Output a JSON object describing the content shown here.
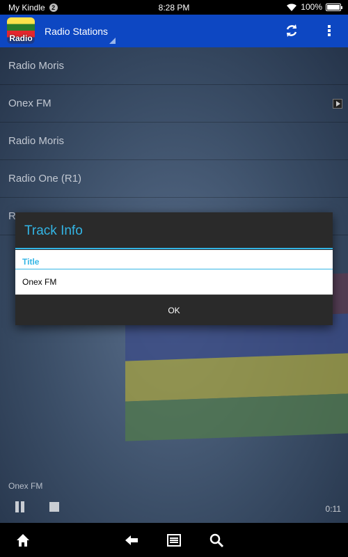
{
  "status_bar": {
    "device_name": "My Kindle",
    "notification_count": "2",
    "time": "8:28 PM",
    "battery_percent": "100%",
    "battery_level": 1.0,
    "icons": [
      "wifi-icon",
      "battery-icon"
    ]
  },
  "action_bar": {
    "app_icon_label": "Radio",
    "title": "Radio Stations",
    "actions": [
      "refresh-icon",
      "overflow-menu-icon"
    ],
    "color": "#0d47c2"
  },
  "stations": [
    {
      "name": "Radio Moris",
      "has_play": false
    },
    {
      "name": "Onex FM",
      "has_play": true
    },
    {
      "name": "Radio Moris",
      "has_play": false
    },
    {
      "name": "Radio One (R1)",
      "has_play": false
    },
    {
      "name": "R",
      "has_play": false
    }
  ],
  "player": {
    "now_playing": "Onex FM",
    "elapsed": "0:11",
    "controls": [
      "pause-icon",
      "stop-icon"
    ]
  },
  "dialog": {
    "title": "Track Info",
    "field_label": "Title",
    "field_value": "Onex FM",
    "ok_label": "OK",
    "accent_color": "#33b5e5"
  },
  "nav_bar": {
    "icons": [
      "home-icon",
      "back-icon",
      "menu-icon",
      "search-icon"
    ]
  }
}
